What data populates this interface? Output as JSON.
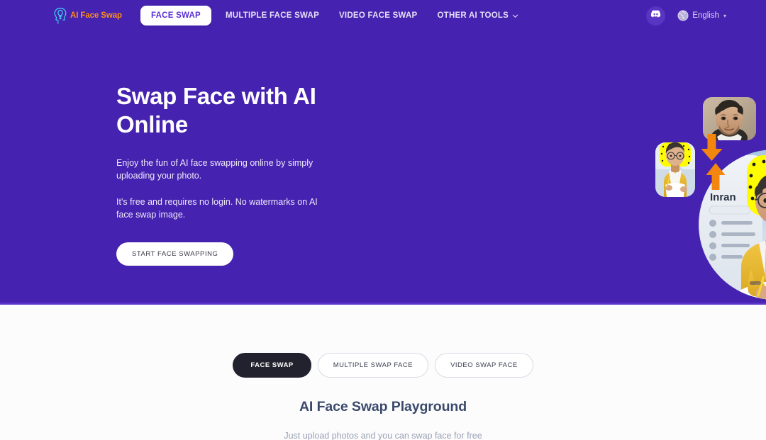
{
  "nav": {
    "logo_text": "AI Face Swap",
    "logo_icon": "head-lightbulb-icon",
    "items": [
      {
        "label": "FACE SWAP",
        "active": true
      },
      {
        "label": "MULTIPLE FACE SWAP",
        "active": false
      },
      {
        "label": "VIDEO FACE SWAP",
        "active": false
      },
      {
        "label": "OTHER AI TOOLS",
        "active": false,
        "caret": true
      }
    ],
    "discord_icon": "discord-icon",
    "globe_icon": "globe-icon",
    "language": "English",
    "language_caret": "▾"
  },
  "hero": {
    "title": "Swap Face with AI Online",
    "paragraph_1": "Enjoy the fun of AI face swapping online by simply uploading your photo.",
    "paragraph_2": "It's free and requires no login. No watermarks on AI face swap image.",
    "cta_label": "START FACE SWAPPING",
    "background_color": "#4622b0",
    "art": {
      "source_face_alt": "source-face-thumbnail",
      "target_photo_alt": "target-photo-thumbnail",
      "result_alt": "swapped-result-image",
      "result_name_label": "Inran",
      "arrow_color": "#f2860f",
      "ghost_logo_color": "#fffc00"
    }
  },
  "playground": {
    "tabs": [
      {
        "label": "FACE SWAP",
        "active": true
      },
      {
        "label": "MULTIPLE SWAP FACE",
        "active": false
      },
      {
        "label": "VIDEO SWAP FACE",
        "active": false
      }
    ],
    "title": "AI Face Swap Playground",
    "subtitle": "Just upload photos and you can swap face for free"
  }
}
